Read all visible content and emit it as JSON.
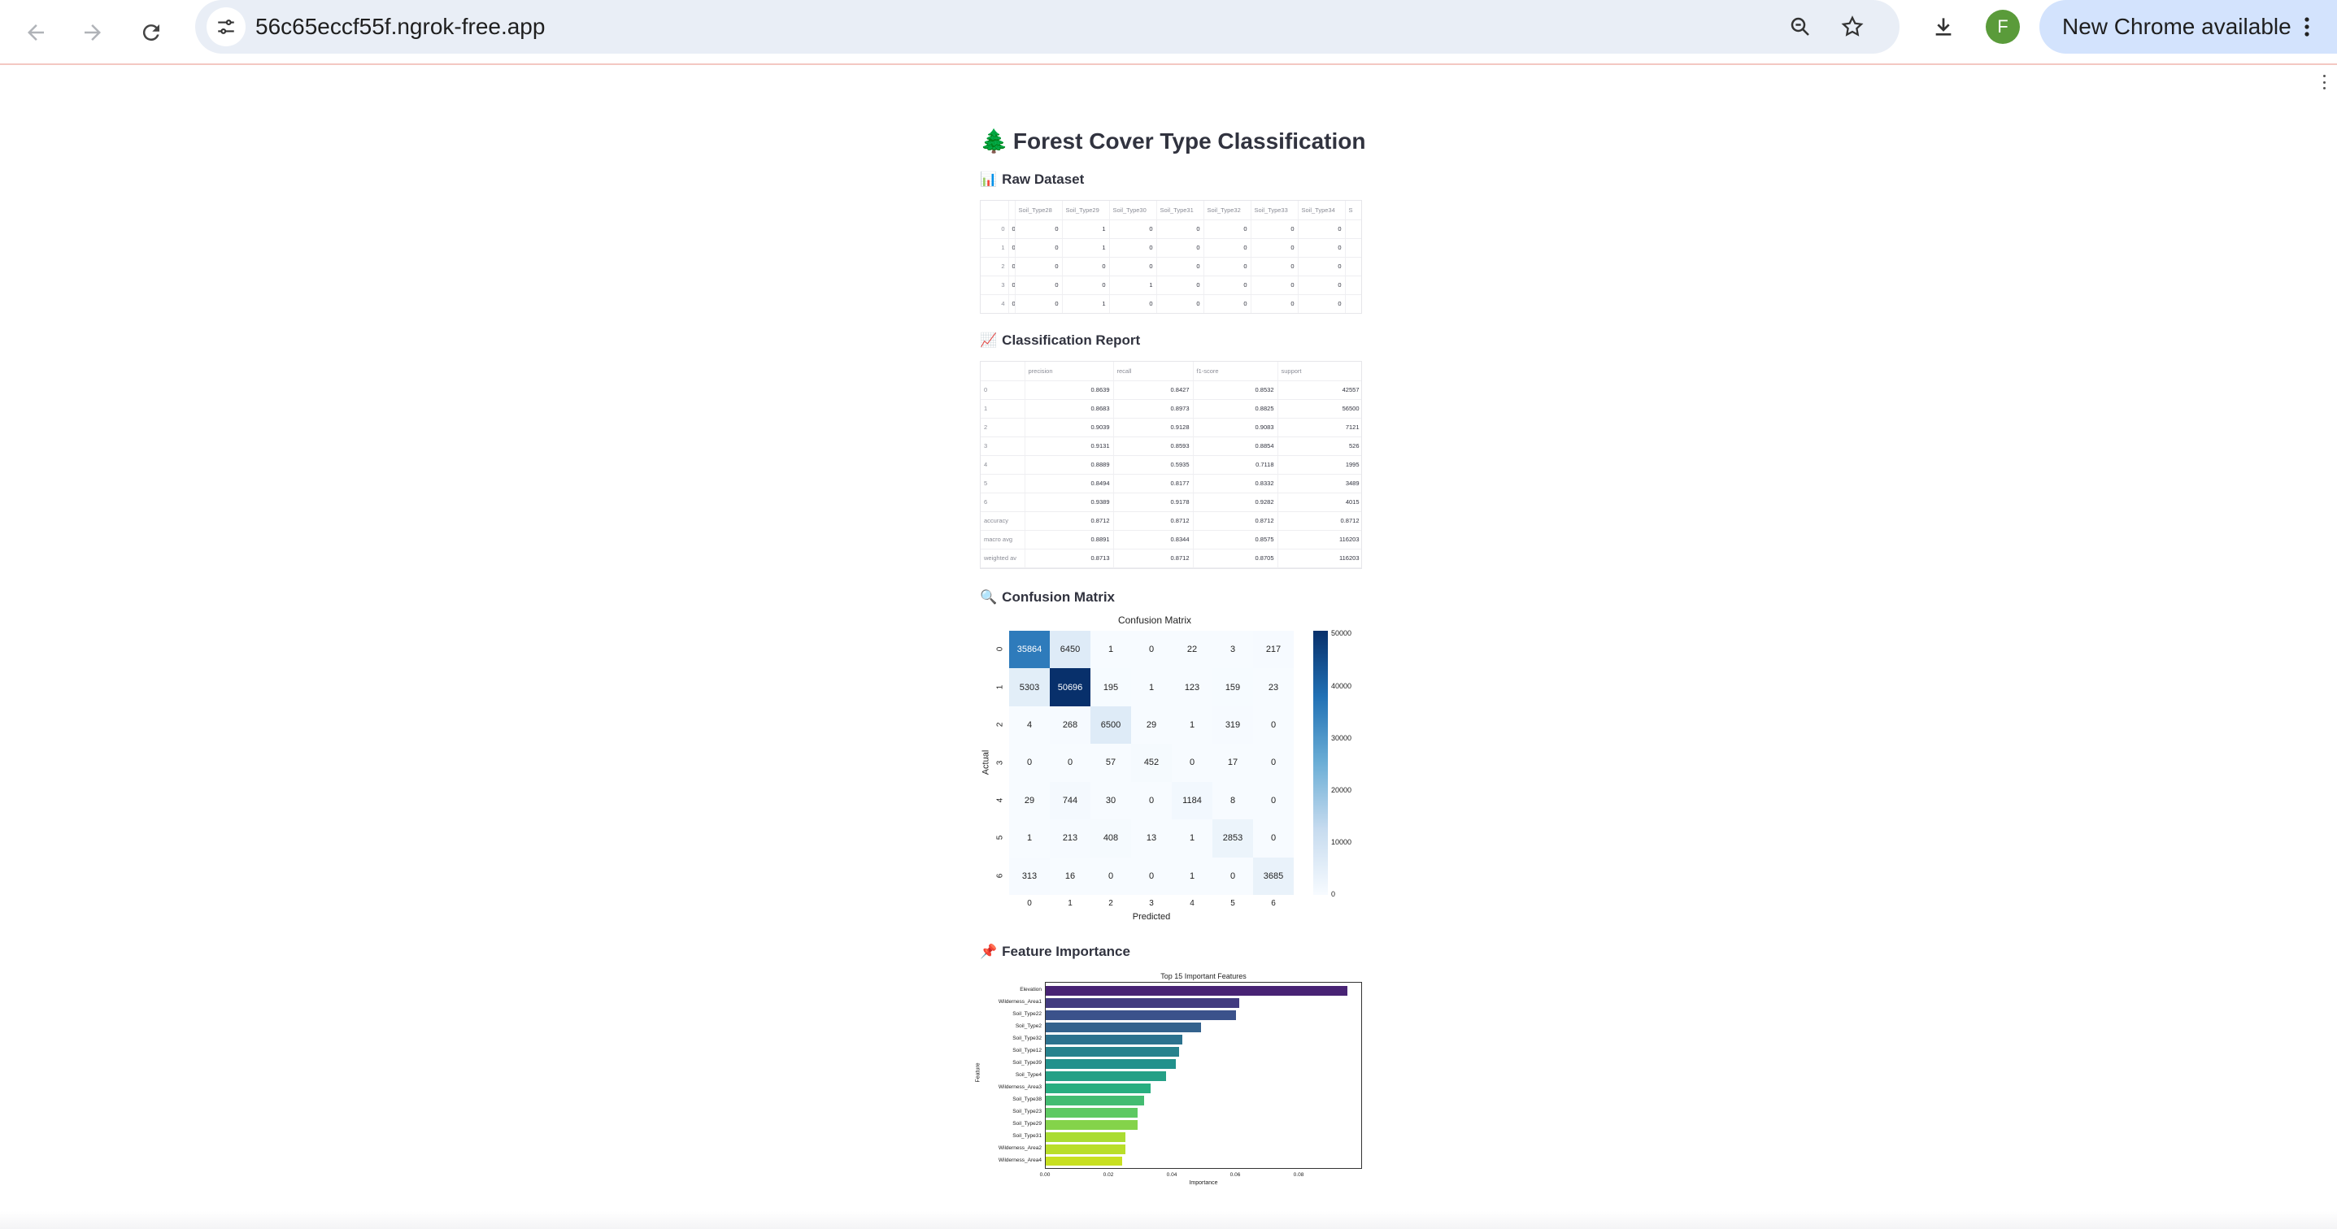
{
  "browser": {
    "url": "56c65eccf55f.ngrok-free.app",
    "update_label": "New Chrome available",
    "avatar_letter": "F",
    "icons": [
      "back-icon",
      "forward-icon",
      "reload-icon",
      "tune-icon",
      "zoom-icon",
      "star-icon",
      "download-icon",
      "kebab-icon"
    ]
  },
  "app": {
    "title_emoji": "🌲",
    "title": "Forest Cover Type Classification",
    "sections": {
      "raw": {
        "emoji": "📊",
        "label": "Raw Dataset"
      },
      "report": {
        "emoji": "📈",
        "label": "Classification Report"
      },
      "cm": {
        "emoji": "🔍",
        "label": "Confusion Matrix"
      },
      "fi": {
        "emoji": "📌",
        "label": "Feature Importance"
      }
    }
  },
  "raw_table": {
    "columns": [
      "",
      "",
      "Soil_Type28",
      "Soil_Type29",
      "Soil_Type30",
      "Soil_Type31",
      "Soil_Type32",
      "Soil_Type33",
      "Soil_Type34",
      "S"
    ],
    "rows": [
      [
        "0",
        "0",
        "0",
        "1",
        "0",
        "0",
        "0",
        "0",
        "0",
        ""
      ],
      [
        "1",
        "0",
        "0",
        "1",
        "0",
        "0",
        "0",
        "0",
        "0",
        ""
      ],
      [
        "2",
        "0",
        "0",
        "0",
        "0",
        "0",
        "0",
        "0",
        "0",
        ""
      ],
      [
        "3",
        "0",
        "0",
        "0",
        "1",
        "0",
        "0",
        "0",
        "0",
        ""
      ],
      [
        "4",
        "0",
        "0",
        "1",
        "0",
        "0",
        "0",
        "0",
        "0",
        ""
      ]
    ]
  },
  "report_table": {
    "columns": [
      "",
      "precision",
      "recall",
      "f1-score",
      "support"
    ],
    "rows": [
      [
        "0",
        "0.8639",
        "0.8427",
        "0.8532",
        "42557"
      ],
      [
        "1",
        "0.8683",
        "0.8973",
        "0.8825",
        "56500"
      ],
      [
        "2",
        "0.9039",
        "0.9128",
        "0.9083",
        "7121"
      ],
      [
        "3",
        "0.9131",
        "0.8593",
        "0.8854",
        "526"
      ],
      [
        "4",
        "0.8889",
        "0.5935",
        "0.7118",
        "1995"
      ],
      [
        "5",
        "0.8494",
        "0.8177",
        "0.8332",
        "3489"
      ],
      [
        "6",
        "0.9389",
        "0.9178",
        "0.9282",
        "4015"
      ],
      [
        "accuracy",
        "0.8712",
        "0.8712",
        "0.8712",
        "0.8712"
      ],
      [
        "macro avg",
        "0.8891",
        "0.8344",
        "0.8575",
        "116203"
      ],
      [
        "weighted av",
        "0.8713",
        "0.8712",
        "0.8705",
        "116203"
      ]
    ]
  },
  "chart_data": [
    {
      "type": "heatmap",
      "title": "Confusion Matrix",
      "xlabel": "Predicted",
      "ylabel": "Actual",
      "x_categories": [
        "0",
        "1",
        "2",
        "3",
        "4",
        "5",
        "6"
      ],
      "y_categories": [
        "0",
        "1",
        "2",
        "3",
        "4",
        "5",
        "6"
      ],
      "values": [
        [
          35864,
          6450,
          1,
          0,
          22,
          3,
          217
        ],
        [
          5303,
          50696,
          195,
          1,
          123,
          159,
          23
        ],
        [
          4,
          268,
          6500,
          29,
          1,
          319,
          0
        ],
        [
          0,
          0,
          57,
          452,
          0,
          17,
          0
        ],
        [
          29,
          744,
          30,
          0,
          1184,
          8,
          0
        ],
        [
          1,
          213,
          408,
          13,
          1,
          2853,
          0
        ],
        [
          313,
          16,
          0,
          0,
          1,
          0,
          3685
        ]
      ],
      "colorbar_ticks": [
        0,
        10000,
        20000,
        30000,
        40000,
        50000
      ],
      "colormap": "Blues",
      "vmax": 50696
    },
    {
      "type": "bar",
      "orientation": "horizontal",
      "title": "Top 15 Important Features",
      "xlabel": "Importance",
      "ylabel": "Feature",
      "categories": [
        "Elevation",
        "Wilderness_Area1",
        "Soil_Type22",
        "Soil_Type2",
        "Soil_Type32",
        "Soil_Type12",
        "Soil_Type39",
        "Soil_Type4",
        "Wilderness_Area3",
        "Soil_Type38",
        "Soil_Type23",
        "Soil_Type29",
        "Soil_Type31",
        "Wilderness_Area2",
        "Wilderness_Area4"
      ],
      "values": [
        0.095,
        0.061,
        0.06,
        0.049,
        0.043,
        0.042,
        0.041,
        0.038,
        0.033,
        0.031,
        0.029,
        0.029,
        0.025,
        0.025,
        0.024
      ],
      "xticks": [
        "0.00",
        "0.02",
        "0.04",
        "0.06",
        "0.08"
      ],
      "xlim": [
        0,
        0.1
      ],
      "colormap": "viridis"
    }
  ]
}
